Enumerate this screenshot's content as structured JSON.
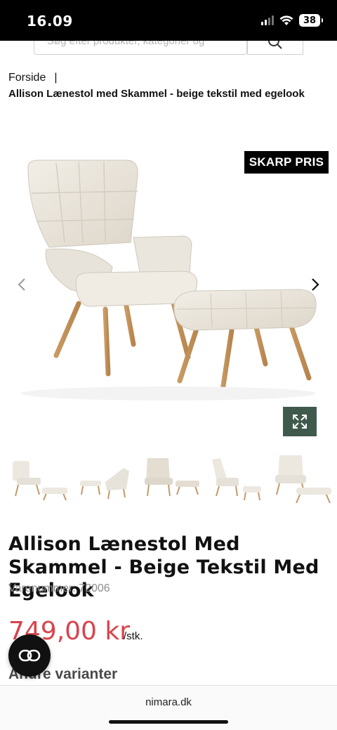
{
  "status_bar": {
    "time": "16.09",
    "battery": "38"
  },
  "search": {
    "placeholder": "Søg efter produkter, kategorier og"
  },
  "breadcrumb": {
    "home": "Forside",
    "separator": "|",
    "current": "Allison Lænestol med Skammel - beige tekstil med egelook"
  },
  "gallery": {
    "badge": "SKARP PRIS",
    "prev_icon": "chevron-left-icon",
    "next_icon": "chevron-right-icon",
    "expand_icon": "expand-icon",
    "expand_color": "#3f5a4d"
  },
  "thumbnails": [
    {
      "name": "thumb-front-angle"
    },
    {
      "name": "thumb-side"
    },
    {
      "name": "thumb-front"
    },
    {
      "name": "thumb-side-back"
    },
    {
      "name": "thumb-front-close"
    }
  ],
  "product": {
    "title": "Allison Lænestol Med Skammel - Beige Tekstil Med Egelook",
    "sku": "Varenummer: 72006",
    "price": "749,00 kr",
    "unit": "/stk.",
    "variants_heading": "Andre varianter",
    "price_color": "#d9434b"
  },
  "chat": {
    "icon": "chat-icon"
  },
  "browser": {
    "url": "nimara.dk"
  }
}
